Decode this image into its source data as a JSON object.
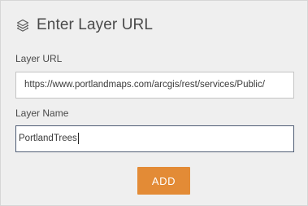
{
  "header": {
    "icon": "layers-icon",
    "title": "Enter Layer URL"
  },
  "url_field": {
    "label": "Layer URL",
    "value": "https://www.portlandmaps.com/arcgis/rest/services/Public/"
  },
  "name_field": {
    "label": "Layer Name",
    "value": "PortlandTrees"
  },
  "add_button": {
    "label": "ADD"
  },
  "colors": {
    "accent": "#e38b36",
    "panel_bg": "#efefef",
    "text": "#4a4a4a"
  }
}
